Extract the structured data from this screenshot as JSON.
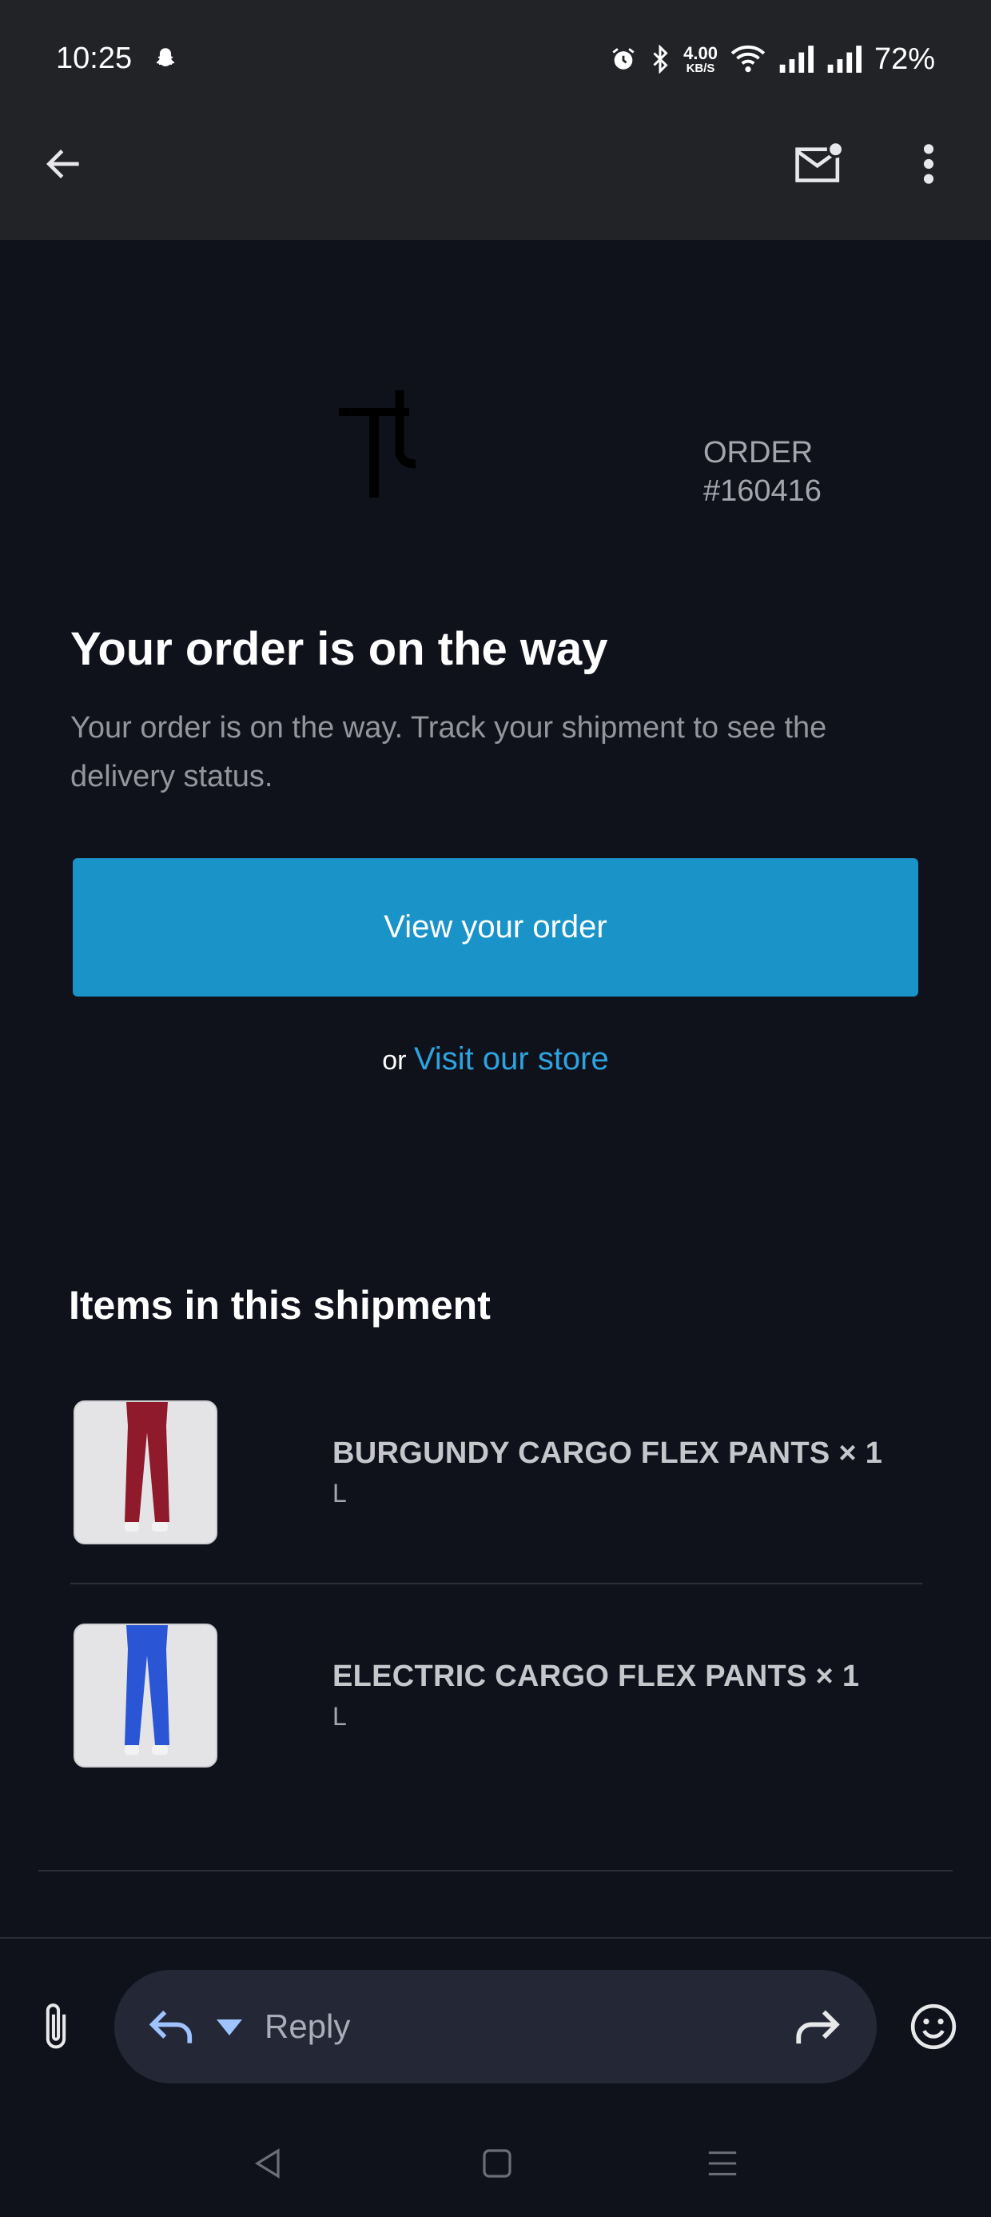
{
  "status_bar": {
    "time": "10:25",
    "net_speed_value": "4.00",
    "net_speed_unit": "KB/S",
    "battery": "72%",
    "icons": [
      "snapchat-ghost-icon",
      "alarm-icon",
      "bluetooth-icon",
      "wifi-icon",
      "signal-icon",
      "signal-icon"
    ]
  },
  "app_bar": {
    "icons": [
      "back-arrow-icon",
      "mark-unread-icon",
      "more-vert-icon"
    ]
  },
  "email": {
    "order_label": "ORDER",
    "order_number": "#160416",
    "headline": "Your order is on the way",
    "body": "Your order is on the way. Track your shipment to see the delivery status.",
    "cta_label": "View your order",
    "or_text": "or",
    "store_link": "Visit our store",
    "items_heading": "Items in this shipment",
    "items": [
      {
        "name": "BURGUNDY CARGO FLEX PANTS × 1",
        "variant": "L",
        "color": "#8e1a2c"
      },
      {
        "name": "ELECTRIC CARGO FLEX PANTS × 1",
        "variant": "L",
        "color": "#2a56d6"
      }
    ]
  },
  "reply_bar": {
    "placeholder": "Reply",
    "icons": [
      "attach-icon",
      "reply-icon",
      "forward-icon",
      "emoji-icon"
    ]
  },
  "nav_bar": {
    "icons": [
      "nav-back-icon",
      "nav-home-icon",
      "nav-recents-icon"
    ]
  },
  "colors": {
    "background": "#0f121b",
    "toolbar": "#222327",
    "accent": "#1a93c9",
    "link": "#2ea3e0"
  }
}
